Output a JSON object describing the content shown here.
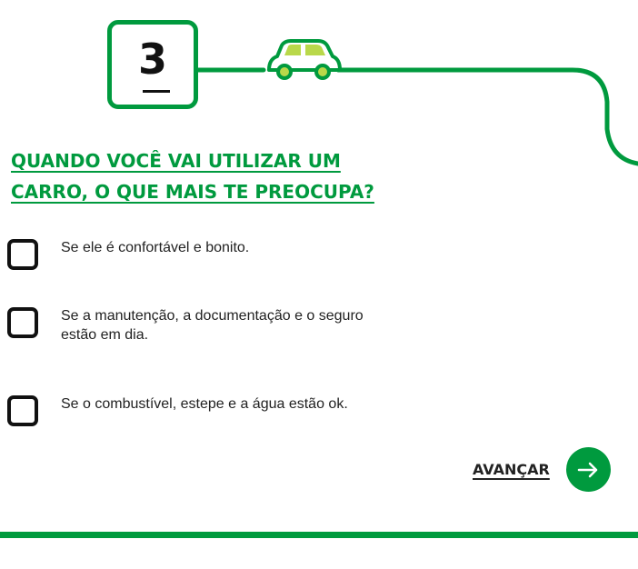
{
  "step": {
    "number": "3"
  },
  "question": {
    "text": "QUANDO VOCÊ VAI UTILIZAR UM CARRO, O QUE MAIS TE PREOCUPA?"
  },
  "options": [
    {
      "label": "Se ele é confortável e bonito.",
      "checked": false
    },
    {
      "label": "Se a manutenção, a documentação e o seguro estão em dia.",
      "checked": false
    },
    {
      "label": "Se o combustível, estepe e a água estão ok.",
      "checked": false
    }
  ],
  "navigation": {
    "next_label": "AVANÇAR",
    "next_icon": "arrow-right-icon"
  },
  "decoration": {
    "car_icon": "car-icon"
  },
  "colors": {
    "primary_green": "#009a3e",
    "light_green": "#b9d84a",
    "text_dark": "#111111"
  }
}
